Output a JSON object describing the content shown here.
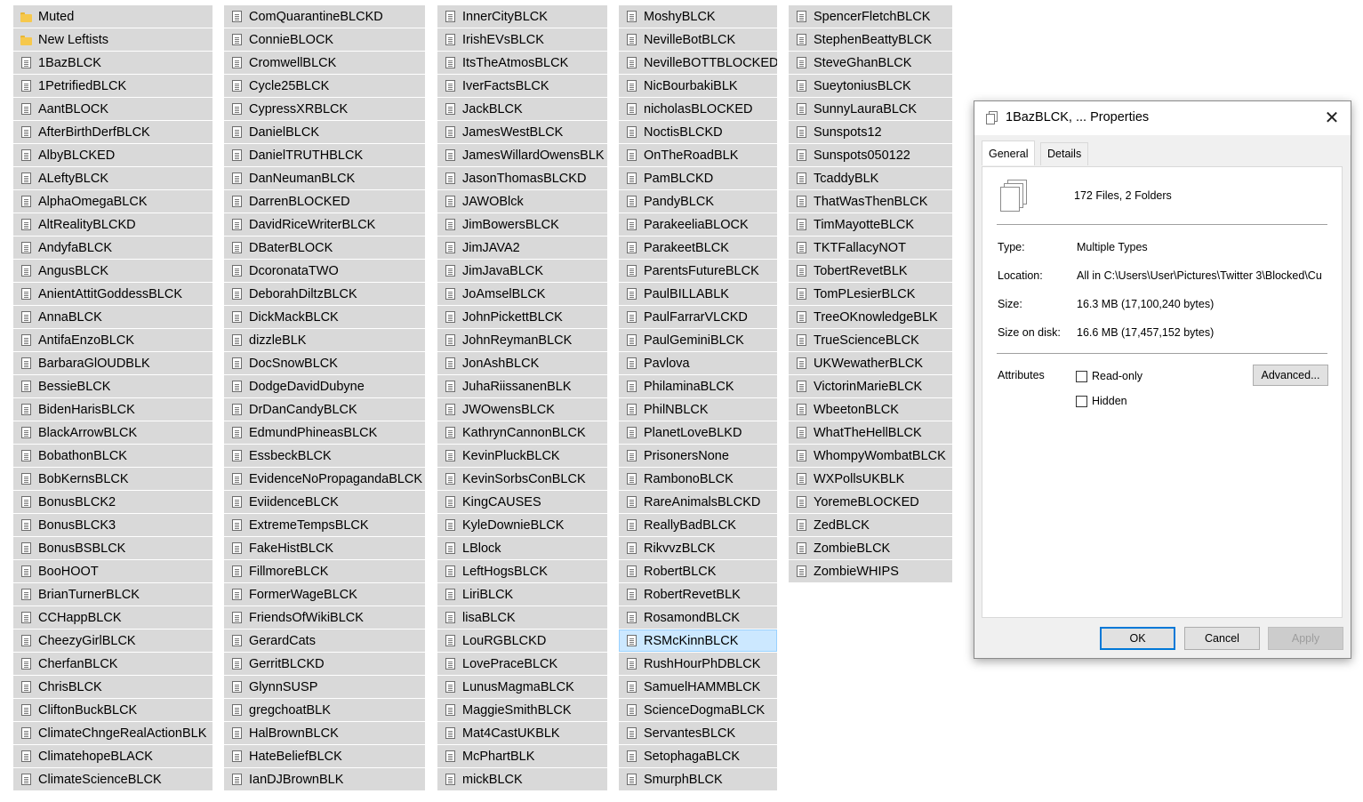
{
  "columns": [
    {
      "items": [
        {
          "label": "Muted",
          "type": "folder"
        },
        {
          "label": "New Leftists",
          "type": "folder"
        },
        {
          "label": "1BazBLCK",
          "type": "file"
        },
        {
          "label": "1PetrifiedBLCK",
          "type": "file"
        },
        {
          "label": "AantBLOCK",
          "type": "file"
        },
        {
          "label": "AfterBirthDerfBLCK",
          "type": "file"
        },
        {
          "label": "AlbyBLCKED",
          "type": "file"
        },
        {
          "label": "ALeftyBLCK",
          "type": "file"
        },
        {
          "label": "AlphaOmegaBLCK",
          "type": "file"
        },
        {
          "label": "AltRealityBLCKD",
          "type": "file"
        },
        {
          "label": "AndyfaBLCK",
          "type": "file"
        },
        {
          "label": "AngusBLCK",
          "type": "file"
        },
        {
          "label": "AnientAttitGoddessBLCK",
          "type": "file"
        },
        {
          "label": "AnnaBLCK",
          "type": "file"
        },
        {
          "label": "AntifaEnzoBLCK",
          "type": "file"
        },
        {
          "label": "BarbaraGlOUDBLK",
          "type": "file"
        },
        {
          "label": "BessieBLCK",
          "type": "file"
        },
        {
          "label": "BidenHarisBLCK",
          "type": "file"
        },
        {
          "label": "BlackArrowBLCK",
          "type": "file"
        },
        {
          "label": "BobathonBLCK",
          "type": "file"
        },
        {
          "label": "BobKernsBLCK",
          "type": "file"
        },
        {
          "label": "BonusBLCK2",
          "type": "file"
        },
        {
          "label": "BonusBLCK3",
          "type": "file"
        },
        {
          "label": "BonusBSBLCK",
          "type": "file"
        },
        {
          "label": "BooHOOT",
          "type": "file"
        },
        {
          "label": "BrianTurnerBLCK",
          "type": "file"
        },
        {
          "label": "CCHappBLCK",
          "type": "file"
        },
        {
          "label": "CheezyGirlBLCK",
          "type": "file"
        },
        {
          "label": "CherfanBLCK",
          "type": "file"
        },
        {
          "label": "ChrisBLCK",
          "type": "file"
        },
        {
          "label": "CliftonBuckBLCK",
          "type": "file"
        },
        {
          "label": "ClimateChngeRealActionBLK",
          "type": "file"
        },
        {
          "label": "ClimatehopeBLACK",
          "type": "file"
        },
        {
          "label": "ClimateScienceBLCK",
          "type": "file"
        }
      ]
    },
    {
      "items": [
        {
          "label": "ComQuarantineBLCKD",
          "type": "file"
        },
        {
          "label": "ConnieBLOCK",
          "type": "file"
        },
        {
          "label": "CromwellBLCK",
          "type": "file"
        },
        {
          "label": "Cycle25BLCK",
          "type": "file"
        },
        {
          "label": "CypressXRBLCK",
          "type": "file"
        },
        {
          "label": "DanielBLCK",
          "type": "file"
        },
        {
          "label": "DanielTRUTHBLCK",
          "type": "file"
        },
        {
          "label": "DanNeumanBLCK",
          "type": "file"
        },
        {
          "label": "DarrenBLOCKED",
          "type": "file"
        },
        {
          "label": "DavidRiceWriterBLCK",
          "type": "file"
        },
        {
          "label": "DBaterBLOCK",
          "type": "file"
        },
        {
          "label": "DcoronataTWO",
          "type": "file"
        },
        {
          "label": "DeborahDiltzBLCK",
          "type": "file"
        },
        {
          "label": "DickMackBLCK",
          "type": "file"
        },
        {
          "label": "dizzleBLK",
          "type": "file"
        },
        {
          "label": "DocSnowBLCK",
          "type": "file"
        },
        {
          "label": "DodgeDavidDubyne",
          "type": "file"
        },
        {
          "label": "DrDanCandyBLCK",
          "type": "file"
        },
        {
          "label": "EdmundPhineasBLCK",
          "type": "file"
        },
        {
          "label": "EssbeckBLCK",
          "type": "file"
        },
        {
          "label": "EvidenceNoPropagandaBLCK",
          "type": "file"
        },
        {
          "label": "EviidenceBLCK",
          "type": "file"
        },
        {
          "label": "ExtremeTempsBLCK",
          "type": "file"
        },
        {
          "label": "FakeHistBLCK",
          "type": "file"
        },
        {
          "label": "FillmoreBLCK",
          "type": "file"
        },
        {
          "label": "FormerWageBLCK",
          "type": "file"
        },
        {
          "label": "FriendsOfWikiBLCK",
          "type": "file"
        },
        {
          "label": "GerardCats",
          "type": "file"
        },
        {
          "label": "GerritBLCKD",
          "type": "file"
        },
        {
          "label": "GlynnSUSP",
          "type": "file"
        },
        {
          "label": "gregchoatBLK",
          "type": "file"
        },
        {
          "label": "HalBrownBLCK",
          "type": "file"
        },
        {
          "label": "HateBeliefBLCK",
          "type": "file"
        },
        {
          "label": "IanDJBrownBLK",
          "type": "file"
        }
      ]
    },
    {
      "items": [
        {
          "label": "InnerCityBLCK",
          "type": "file"
        },
        {
          "label": "IrishEVsBLCK",
          "type": "file"
        },
        {
          "label": "ItsTheAtmosBLCK",
          "type": "file"
        },
        {
          "label": "IverFactsBLCK",
          "type": "file"
        },
        {
          "label": "JackBLCK",
          "type": "file"
        },
        {
          "label": "JamesWestBLCK",
          "type": "file"
        },
        {
          "label": "JamesWillardOwensBLK",
          "type": "file"
        },
        {
          "label": "JasonThomasBLCKD",
          "type": "file"
        },
        {
          "label": "JAWOBlck",
          "type": "file"
        },
        {
          "label": "JimBowersBLCK",
          "type": "file"
        },
        {
          "label": "JimJAVA2",
          "type": "file"
        },
        {
          "label": "JimJavaBLCK",
          "type": "file"
        },
        {
          "label": "JoAmselBLCK",
          "type": "file"
        },
        {
          "label": "JohnPickettBLCK",
          "type": "file"
        },
        {
          "label": "JohnReymanBLCK",
          "type": "file"
        },
        {
          "label": "JonAshBLCK",
          "type": "file"
        },
        {
          "label": "JuhaRiissanenBLK",
          "type": "file"
        },
        {
          "label": "JWOwensBLCK",
          "type": "file"
        },
        {
          "label": "KathrynCannonBLCK",
          "type": "file"
        },
        {
          "label": "KevinPluckBLCK",
          "type": "file"
        },
        {
          "label": "KevinSorbsConBLCK",
          "type": "file"
        },
        {
          "label": "KingCAUSES",
          "type": "file"
        },
        {
          "label": "KyleDownieBLCK",
          "type": "file"
        },
        {
          "label": "LBlock",
          "type": "file"
        },
        {
          "label": "LeftHogsBLCK",
          "type": "file"
        },
        {
          "label": "LiriBLCK",
          "type": "file"
        },
        {
          "label": "lisaBLCK",
          "type": "file"
        },
        {
          "label": "LouRGBLCKD",
          "type": "file"
        },
        {
          "label": "LovePraceBLCK",
          "type": "file"
        },
        {
          "label": "LunusMagmaBLCK",
          "type": "file"
        },
        {
          "label": "MaggieSmithBLCK",
          "type": "file"
        },
        {
          "label": "Mat4CastUKBLK",
          "type": "file"
        },
        {
          "label": "McPhartBLK",
          "type": "file"
        },
        {
          "label": "mickBLCK",
          "type": "file"
        }
      ]
    },
    {
      "items": [
        {
          "label": "MoshyBLCK",
          "type": "file"
        },
        {
          "label": "NevilleBotBLCK",
          "type": "file"
        },
        {
          "label": "NevilleBOTTBLOCKED",
          "type": "file"
        },
        {
          "label": "NicBourbakiBLK",
          "type": "file"
        },
        {
          "label": "nicholasBLOCKED",
          "type": "file"
        },
        {
          "label": "NoctisBLCKD",
          "type": "file"
        },
        {
          "label": "OnTheRoadBLK",
          "type": "file"
        },
        {
          "label": "PamBLCKD",
          "type": "file"
        },
        {
          "label": "PandyBLCK",
          "type": "file"
        },
        {
          "label": "ParakeeliaBLOCK",
          "type": "file"
        },
        {
          "label": "ParakeetBLCK",
          "type": "file"
        },
        {
          "label": "ParentsFutureBLCK",
          "type": "file"
        },
        {
          "label": "PaulBILLABLK",
          "type": "file"
        },
        {
          "label": "PaulFarrarVLCKD",
          "type": "file"
        },
        {
          "label": "PaulGeminiBLCK",
          "type": "file"
        },
        {
          "label": "Pavlova",
          "type": "file"
        },
        {
          "label": "PhilaminaBLCK",
          "type": "file"
        },
        {
          "label": "PhilNBLCK",
          "type": "file"
        },
        {
          "label": "PlanetLoveBLKD",
          "type": "file"
        },
        {
          "label": "PrisonersNone",
          "type": "file"
        },
        {
          "label": "RambonoBLCK",
          "type": "file"
        },
        {
          "label": "RareAnimalsBLCKD",
          "type": "file"
        },
        {
          "label": "ReallyBadBLCK",
          "type": "file"
        },
        {
          "label": "RikvvzBLCK",
          "type": "file"
        },
        {
          "label": "RobertBLCK",
          "type": "file"
        },
        {
          "label": "RobertRevetBLK",
          "type": "file"
        },
        {
          "label": "RosamondBLCK",
          "type": "file"
        },
        {
          "label": "RSMcKinnBLCK",
          "type": "file",
          "selected": true
        },
        {
          "label": "RushHourPhDBLCK",
          "type": "file"
        },
        {
          "label": "SamuelHAMMBLCK",
          "type": "file"
        },
        {
          "label": "ScienceDogmaBLCK",
          "type": "file"
        },
        {
          "label": "ServantesBLCK",
          "type": "file"
        },
        {
          "label": "SetophagaBLCK",
          "type": "file"
        },
        {
          "label": "SmurphBLCK",
          "type": "file"
        }
      ]
    },
    {
      "items": [
        {
          "label": "SpencerFletchBLCK",
          "type": "file"
        },
        {
          "label": "StephenBeattyBLCK",
          "type": "file"
        },
        {
          "label": "SteveGhanBLCK",
          "type": "file"
        },
        {
          "label": "SueytoniusBLCK",
          "type": "file"
        },
        {
          "label": "SunnyLauraBLCK",
          "type": "file"
        },
        {
          "label": "Sunspots12",
          "type": "file"
        },
        {
          "label": "Sunspots050122",
          "type": "file"
        },
        {
          "label": "TcaddyBLK",
          "type": "file"
        },
        {
          "label": "ThatWasThenBLCK",
          "type": "file"
        },
        {
          "label": "TimMayotteBLCK",
          "type": "file"
        },
        {
          "label": "TKTFallacyNOT",
          "type": "file"
        },
        {
          "label": "TobertRevetBLK",
          "type": "file"
        },
        {
          "label": "TomPLesierBLCK",
          "type": "file"
        },
        {
          "label": "TreeOKnowledgeBLK",
          "type": "file"
        },
        {
          "label": "TrueScienceBLCK",
          "type": "file"
        },
        {
          "label": "UKWewatherBLCK",
          "type": "file"
        },
        {
          "label": "VictorinMarieBLCK",
          "type": "file"
        },
        {
          "label": "WbeetonBLCK",
          "type": "file"
        },
        {
          "label": "WhatTheHellBLCK",
          "type": "file"
        },
        {
          "label": "WhompyWombatBLCK",
          "type": "file"
        },
        {
          "label": "WXPollsUKBLK",
          "type": "file"
        },
        {
          "label": "YoremeBLOCKED",
          "type": "file"
        },
        {
          "label": "ZedBLCK",
          "type": "file"
        },
        {
          "label": "ZombieBLCK",
          "type": "file"
        },
        {
          "label": "ZombieWHIPS",
          "type": "file"
        }
      ]
    }
  ],
  "dialog": {
    "title": "1BazBLCK, ... Properties",
    "close_glyph": "✕",
    "tabs": [
      "General",
      "Details"
    ],
    "active_tab": "General",
    "summary": "172 Files, 2 Folders",
    "type_label": "Type:",
    "type_value": "Multiple Types",
    "location_label": "Location:",
    "location_value": "All in C:\\Users\\User\\Pictures\\Twitter 3\\Blocked\\Cu",
    "size_label": "Size:",
    "size_value": "16.3 MB (17,100,240 bytes)",
    "size_on_disk_label": "Size on disk:",
    "size_on_disk_value": "16.6 MB (17,457,152 bytes)",
    "attributes_label": "Attributes",
    "readonly_label": "Read-only",
    "readonly_checked": false,
    "hidden_label": "Hidden",
    "hidden_checked": false,
    "advanced_label": "Advanced...",
    "ok_label": "OK",
    "cancel_label": "Cancel",
    "apply_label": "Apply"
  },
  "colors": {
    "item_bg": "#d9d9d9",
    "selected_bg": "#cce8ff",
    "ok_border": "#0078d7"
  }
}
